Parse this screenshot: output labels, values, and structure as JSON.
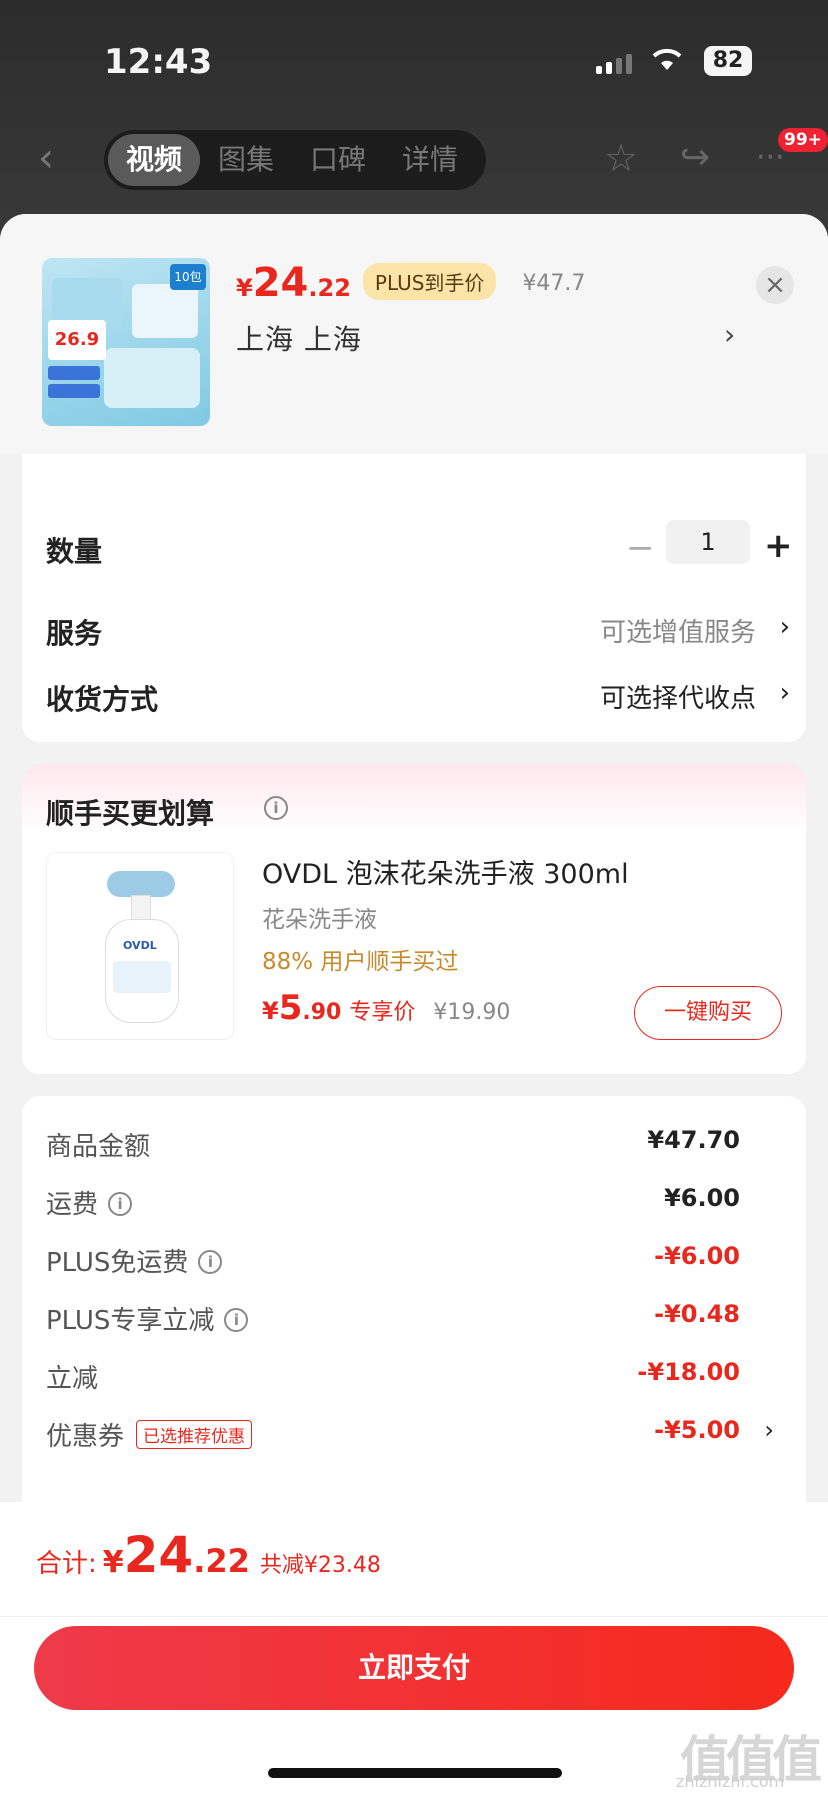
{
  "status_bar": {
    "time": "12:43",
    "battery": "82"
  },
  "top_nav": {
    "tabs": [
      "视频",
      "图集",
      "口碑",
      "详情"
    ],
    "active_tab": "视频",
    "badge": "99+"
  },
  "product": {
    "price_yen": "¥",
    "price_int": "24",
    "price_dec": ".22",
    "plus_label": "PLUS到手价",
    "original_price": "¥47.7",
    "address": "上海  上海",
    "thumb_badge": "10包",
    "thumb_price": "26.9"
  },
  "options": {
    "quantity_label": "数量",
    "quantity_value": "1",
    "service_label": "服务",
    "service_value": "可选增值服务",
    "delivery_label": "收货方式",
    "delivery_value": "可选择代收点"
  },
  "suggestion": {
    "title": "顺手买更划算",
    "name": "OVDL 泡沫花朵洗手液 300ml",
    "subtitle": "花朵洗手液",
    "buyers": "88% 用户顺手买过",
    "price_yen": "¥",
    "price_int": "5",
    "price_dec": ".90",
    "price_label": "专享价",
    "old_price": "¥19.90",
    "buy_button": "一键购买",
    "brand": "OVDL"
  },
  "costs": [
    {
      "label": "商品金额",
      "value": "¥47.70",
      "info": false,
      "red": false
    },
    {
      "label": "运费",
      "value": "¥6.00",
      "info": true,
      "red": false
    },
    {
      "label": "PLUS免运费",
      "value": "-¥6.00",
      "info": true,
      "red": true
    },
    {
      "label": "PLUS专享立减",
      "value": "-¥0.48",
      "info": true,
      "red": true
    },
    {
      "label": "立减",
      "value": "-¥18.00",
      "info": false,
      "red": true
    },
    {
      "label": "优惠券",
      "value": "-¥5.00",
      "info": false,
      "red": true,
      "tag": "已选推荐优惠",
      "chevron": true
    }
  ],
  "total": {
    "label": "合计:",
    "yen": "¥",
    "int": "24",
    "dec": ".22",
    "savings": "共减¥23.48"
  },
  "pay_button": "立即支付",
  "watermark": {
    "mark": "值值值",
    "site": "zhizhizhi.com"
  },
  "colors": {
    "accent_red": "#e8281e",
    "plus_gold": "#fbe4a8",
    "buyers_orange": "#c98a2c"
  }
}
